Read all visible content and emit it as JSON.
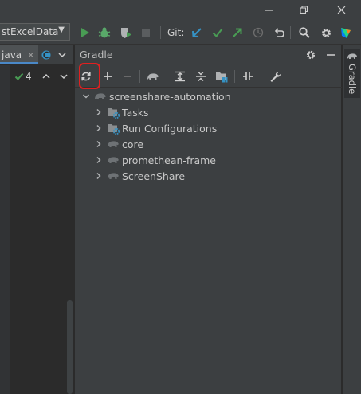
{
  "run_config": {
    "label": "stExcelData"
  },
  "toolbar": {
    "git_label": "Git:"
  },
  "editor": {
    "tabs": [
      {
        "label": "java"
      }
    ],
    "inspection_count": "4"
  },
  "gradle": {
    "title": "Gradle",
    "tree": {
      "root": "screenshare-automation",
      "children": [
        {
          "label": "Tasks",
          "icon": "folder-gear-icon"
        },
        {
          "label": "Run Configurations",
          "icon": "folder-gear-icon"
        },
        {
          "label": "core",
          "icon": "gradle-elephant-icon"
        },
        {
          "label": "promethean-frame",
          "icon": "gradle-elephant-icon"
        },
        {
          "label": "ScreenShare",
          "icon": "gradle-elephant-icon"
        }
      ]
    }
  },
  "side_stripe": {
    "label": "Gradle"
  },
  "colors": {
    "accent_green": "#499c54",
    "accent_blue": "#3592c4",
    "highlight_red": "#e02020",
    "bug_green": "#59a869"
  }
}
